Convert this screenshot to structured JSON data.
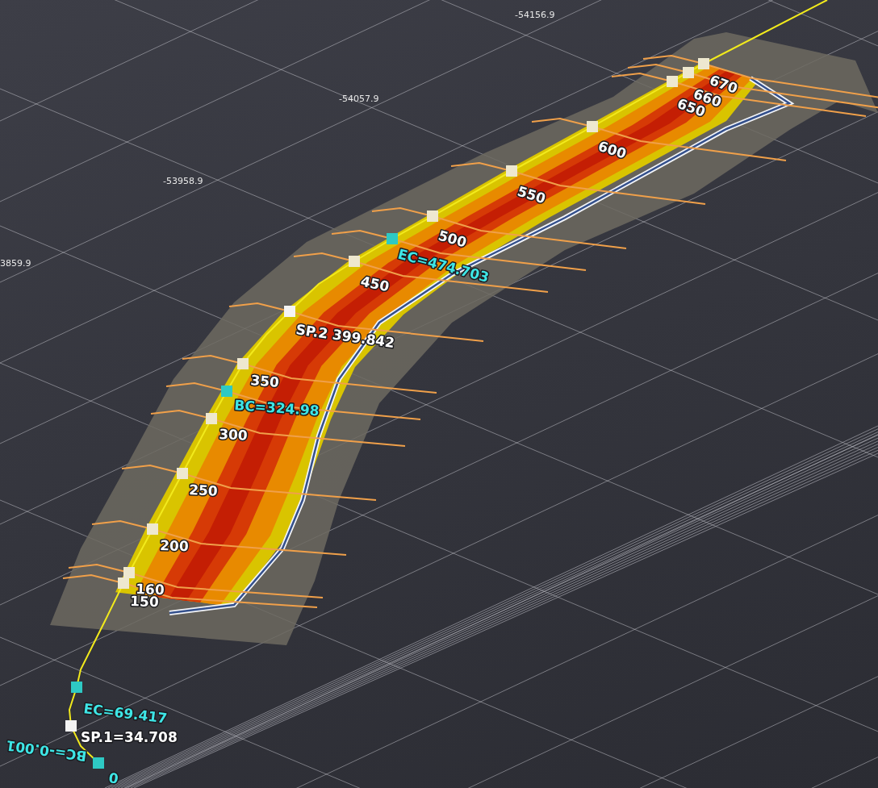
{
  "coordinate_labels": [
    "-54156.9",
    "-54057.9",
    "-53958.9",
    "3859.9"
  ],
  "markers": [
    {
      "label": "670",
      "kind": "station",
      "flipped": false
    },
    {
      "label": "660",
      "kind": "station",
      "flipped": false
    },
    {
      "label": "650",
      "kind": "station",
      "flipped": false
    },
    {
      "label": "600",
      "kind": "station",
      "flipped": false
    },
    {
      "label": "550",
      "kind": "station",
      "flipped": false
    },
    {
      "label": "500",
      "kind": "station",
      "flipped": false
    },
    {
      "label": "EC=474.703",
      "kind": "curve",
      "flipped": false
    },
    {
      "label": "450",
      "kind": "station",
      "flipped": false
    },
    {
      "label": "SP.2 399.842",
      "kind": "spiral",
      "flipped": false
    },
    {
      "label": "350",
      "kind": "station",
      "flipped": false
    },
    {
      "label": "BC=324.98",
      "kind": "curve",
      "flipped": false
    },
    {
      "label": "300",
      "kind": "station",
      "flipped": false
    },
    {
      "label": "250",
      "kind": "station",
      "flipped": false
    },
    {
      "label": "200",
      "kind": "station",
      "flipped": false
    },
    {
      "label": "160",
      "kind": "station",
      "flipped": false
    },
    {
      "label": "150",
      "kind": "station",
      "flipped": false
    },
    {
      "label": "EC=69.417",
      "kind": "curve",
      "flipped": false
    },
    {
      "label": "SP.1=34.708",
      "kind": "spiral",
      "flipped": false
    },
    {
      "label": "BC=-0.001",
      "kind": "curve",
      "flipped": true,
      "station": "0"
    }
  ]
}
